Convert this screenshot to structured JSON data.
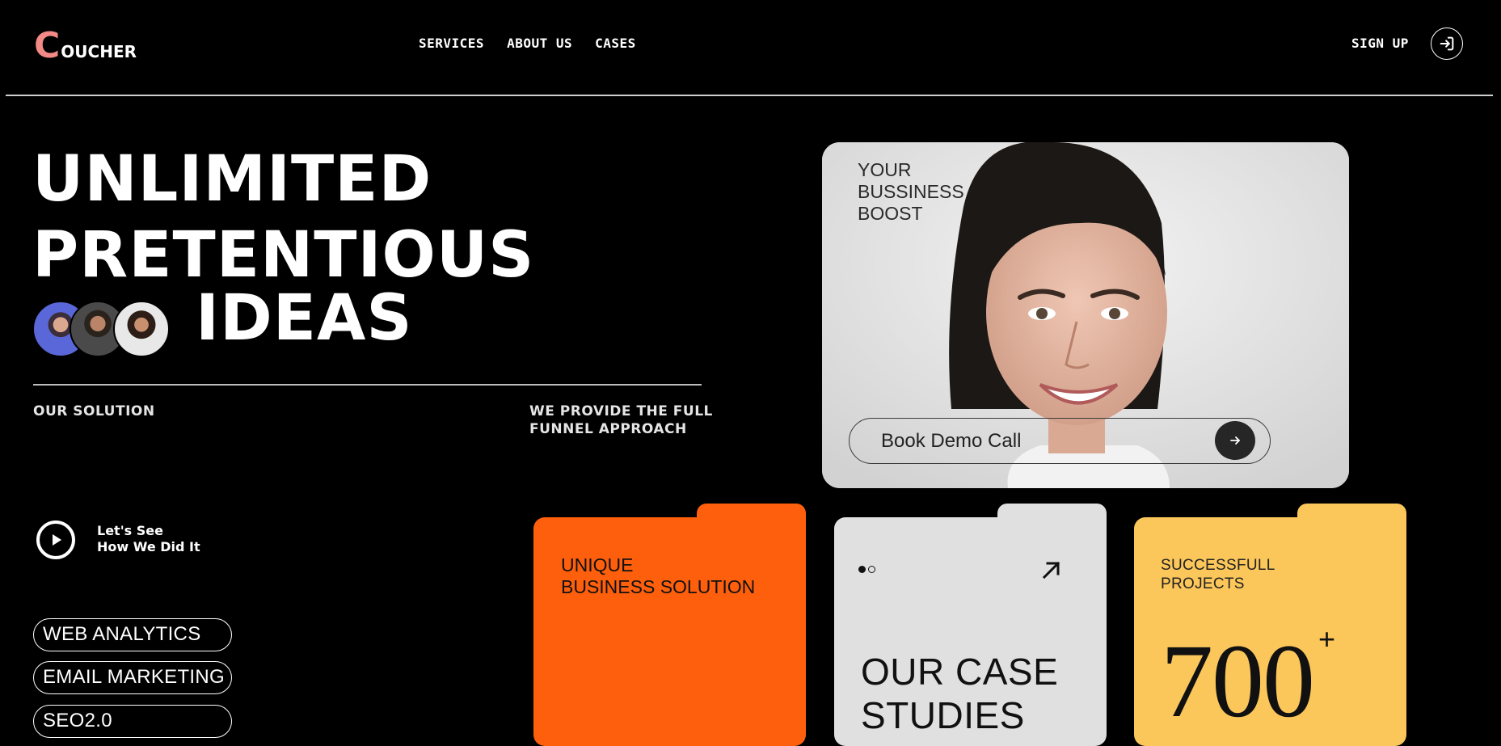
{
  "header": {
    "logo_initial": "C",
    "logo_rest": "OUCHER",
    "nav": [
      "SERVICES",
      "ABOUT US",
      "CASES"
    ],
    "signup_label": "SIGN UP"
  },
  "hero": {
    "line1": "UNLIMITED",
    "line2": "PRETENTIOUS",
    "line3": "IDEAS",
    "our_solution": "OUR SOLUTION",
    "funnel_line1": "WE PROVIDE THE FULL",
    "funnel_line2": "FUNNEL APPROACH"
  },
  "video": {
    "line1": "Let's See",
    "line2": "How We Did It"
  },
  "tags": [
    "WEB ANALYTICS",
    "EMAIL MARKETING",
    "SEO2.0"
  ],
  "photo_card": {
    "boost_lines": [
      "YOUR",
      "BUSSINESS",
      "BOOST"
    ],
    "demo_label": "Book Demo Call"
  },
  "cards": {
    "unique_line1": "UNIQUE",
    "unique_line2": "BUSINESS SOLUTION",
    "case_line1": "OUR CASE",
    "case_line2": "STUDIES",
    "success_line1": "SUCCESSFULL",
    "success_line2": "PROJECTS",
    "projects_count": "700",
    "projects_suffix": "+"
  },
  "colors": {
    "background": "#000000",
    "logo_accent": "#f48a86",
    "orange": "#fd5f0c",
    "grey": "#e0e0e0",
    "yellow": "#fcc75a"
  },
  "icons": [
    "login-icon",
    "play-icon",
    "arrow-right-icon",
    "arrow-up-right-icon"
  ]
}
